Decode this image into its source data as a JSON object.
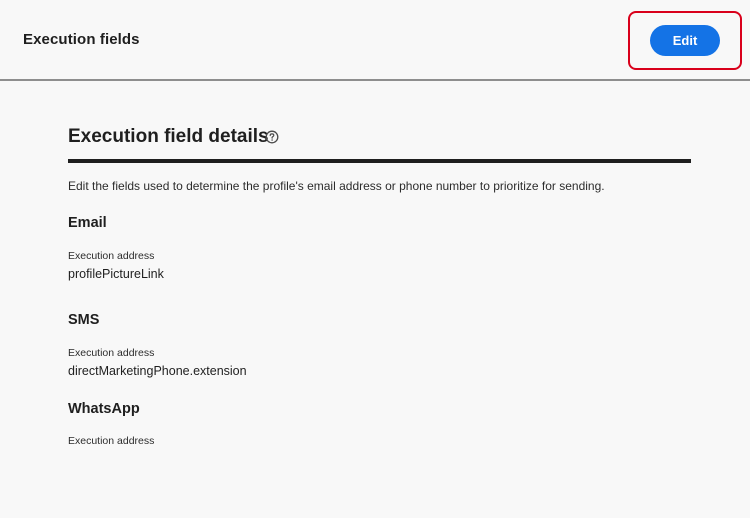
{
  "header": {
    "title": "Execution fields",
    "edit_label": "Edit"
  },
  "details": {
    "heading": "Execution field details",
    "help_icon": "help-circle-icon",
    "description": "Edit the fields used to determine the profile's email address or phone number to prioritize for sending."
  },
  "channels": {
    "email": {
      "title": "Email",
      "field_label": "Execution address",
      "field_value": "profilePictureLink"
    },
    "sms": {
      "title": "SMS",
      "field_label": "Execution address",
      "field_value": "directMarketingPhone.extension"
    },
    "whatsapp": {
      "title": "WhatsApp",
      "field_label": "Execution address",
      "field_value": ""
    }
  },
  "colors": {
    "accent": "#1473e6",
    "highlight": "#d9001b",
    "background": "#f8f8f8"
  }
}
